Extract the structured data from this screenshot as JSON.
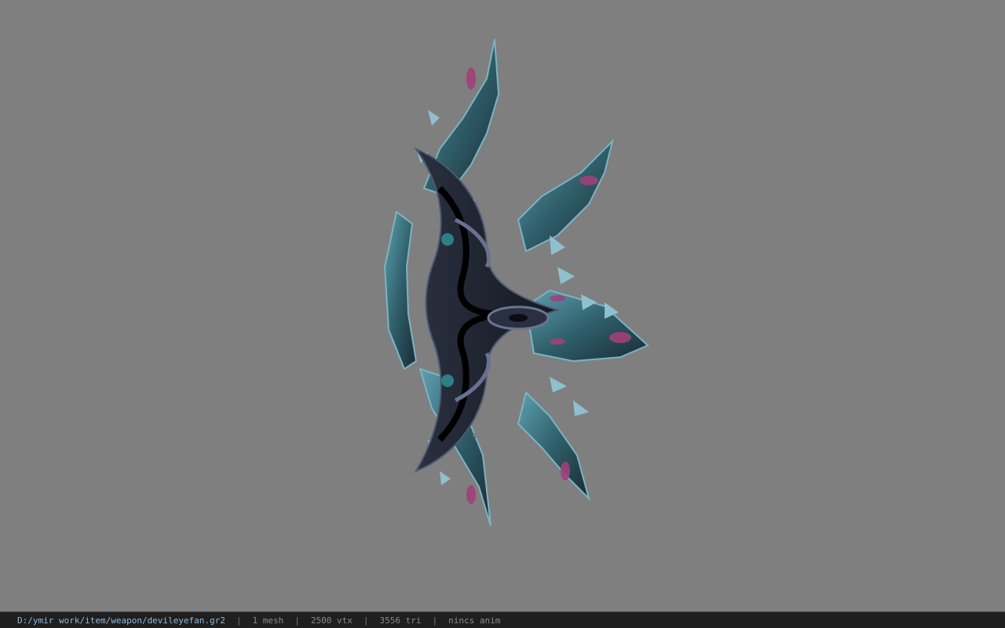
{
  "viewport": {
    "background": "#7f7f7f",
    "model_icon": "devil-eye-fan-weapon-model"
  },
  "statusbar": {
    "file_path": "D:/ymir work/item/weapon/devileyefan.gr2",
    "separator": "|",
    "mesh": "1 mesh",
    "vtx": "2500 vtx",
    "tri": "3556 tri",
    "anim": "nincs anim"
  }
}
